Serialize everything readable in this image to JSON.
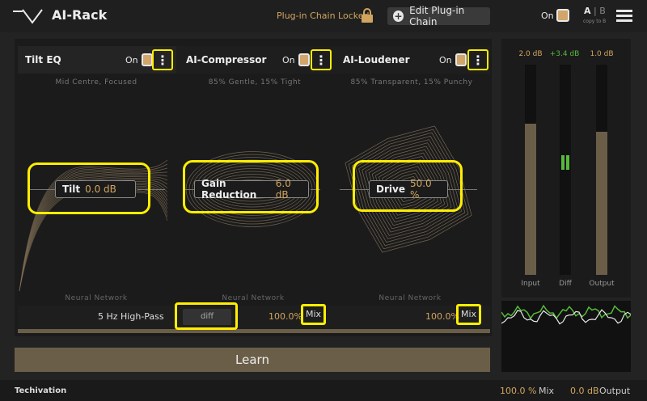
{
  "header": {
    "title": "AI-Rack",
    "chain_locked": "Plug-in Chain Locked",
    "edit_chain": "Edit Plug-in Chain",
    "on_label": "On",
    "ab_a": "A",
    "ab_sep": " | ",
    "ab_b": "B",
    "copy": "copy to B"
  },
  "modules": [
    {
      "name": "Tilt EQ",
      "on": "On",
      "desc": "Mid Centre, Focused",
      "param_name": "Tilt",
      "param_value": "0.0 dB",
      "nn": "Neural Network"
    },
    {
      "name": "AI-Compressor",
      "on": "On",
      "desc": "85% Gentle, 15% Tight",
      "param_name": "Gain Reduction",
      "param_value": "6.0 dB",
      "nn": "Neural Network"
    },
    {
      "name": "AI-Loudener",
      "on": "On",
      "desc": "85% Transparent, 15% Punchy",
      "param_name": "Drive",
      "param_value": "50.0 %",
      "nn": "Neural Network"
    }
  ],
  "strip": {
    "highpass": "5 Hz  High-Pass",
    "diff": "diff",
    "mix1_value": "100.0%",
    "mix1_label": "Mix",
    "mix2_value": "100.0%",
    "mix2_label": "Mix"
  },
  "learn": "Learn",
  "meters": {
    "input_value": "2.0 dB",
    "diff_value": "+3.4 dB",
    "output_value": "1.0 dB",
    "input_label": "Input",
    "diff_label": "Diff",
    "output_label": "Output",
    "input_level": 0.72,
    "output_level": 0.68
  },
  "footer": {
    "brand": "Techivation",
    "mix_value": "100.0 %",
    "mix_label": "Mix",
    "output_value": "0.0 dB",
    "output_label": "Output"
  },
  "colors": {
    "accent": "#d2a55f",
    "highlight": "#ffee00",
    "diff_green": "#56b93b"
  }
}
